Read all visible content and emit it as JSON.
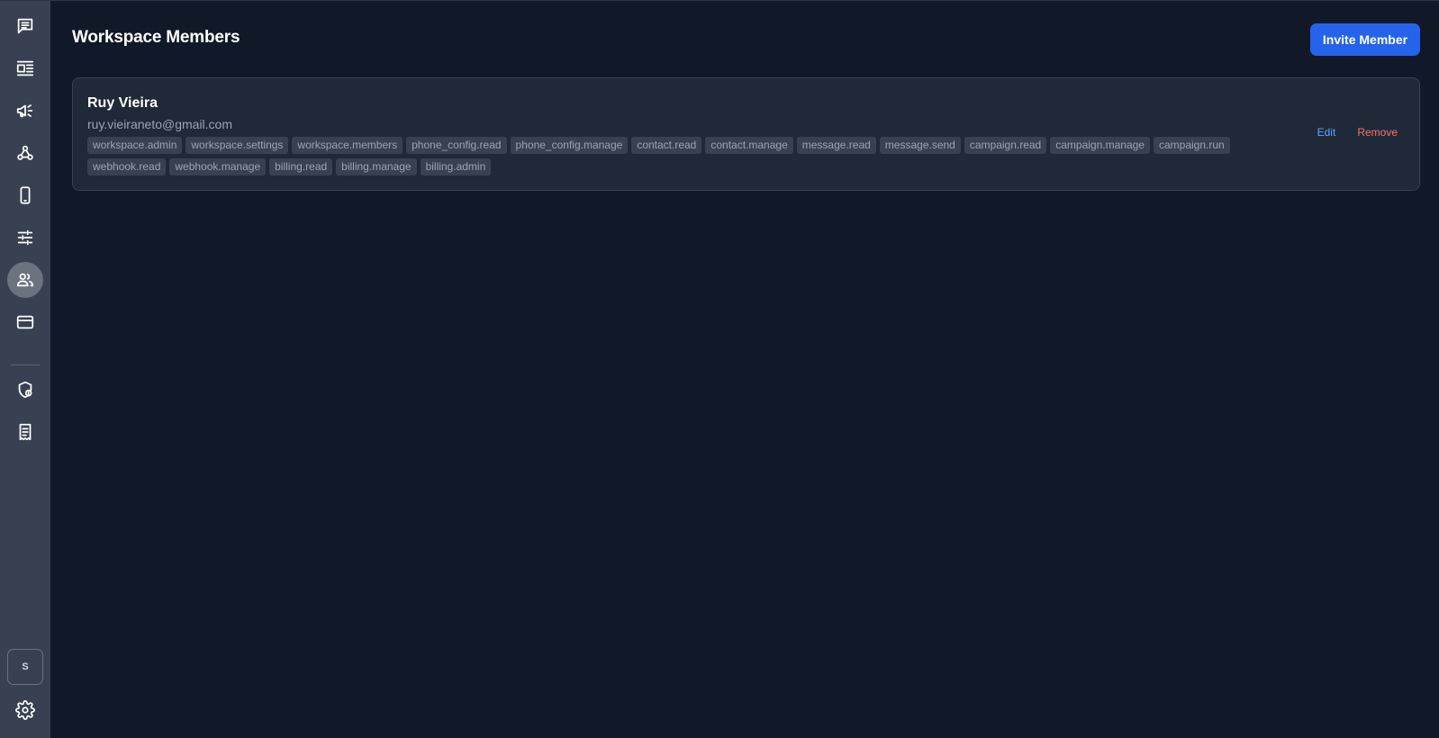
{
  "sidebar": {
    "items": [
      {
        "name": "chat-icon",
        "active": false
      },
      {
        "name": "templates-icon",
        "active": false
      },
      {
        "name": "megaphone-icon",
        "active": false
      },
      {
        "name": "webhook-icon",
        "active": false
      },
      {
        "name": "phone-icon",
        "active": false
      },
      {
        "name": "sliders-icon",
        "active": false
      },
      {
        "name": "users-icon",
        "active": true
      },
      {
        "name": "credit-card-icon",
        "active": false
      },
      {
        "name": "shield-icon",
        "active": false
      },
      {
        "name": "receipt-icon",
        "active": false
      }
    ],
    "workspace_initial": "S",
    "settings_icon": "gear-icon"
  },
  "header": {
    "title": "Workspace Members",
    "invite_label": "Invite Member"
  },
  "members": [
    {
      "name": "Ruy Vieira",
      "email": "ruy.vieiraneto@gmail.com",
      "permissions": [
        "workspace.admin",
        "workspace.settings",
        "workspace.members",
        "phone_config.read",
        "phone_config.manage",
        "contact.read",
        "contact.manage",
        "message.read",
        "message.send",
        "campaign.read",
        "campaign.manage",
        "campaign.run",
        "webhook.read",
        "webhook.manage",
        "billing.read",
        "billing.manage",
        "billing.admin"
      ],
      "edit_label": "Edit",
      "remove_label": "Remove"
    }
  ],
  "colors": {
    "background": "#111827",
    "sidebar": "#374151",
    "card": "#1f2937",
    "accent": "#2563eb",
    "edit": "#60a5fa",
    "remove": "#f87171"
  }
}
